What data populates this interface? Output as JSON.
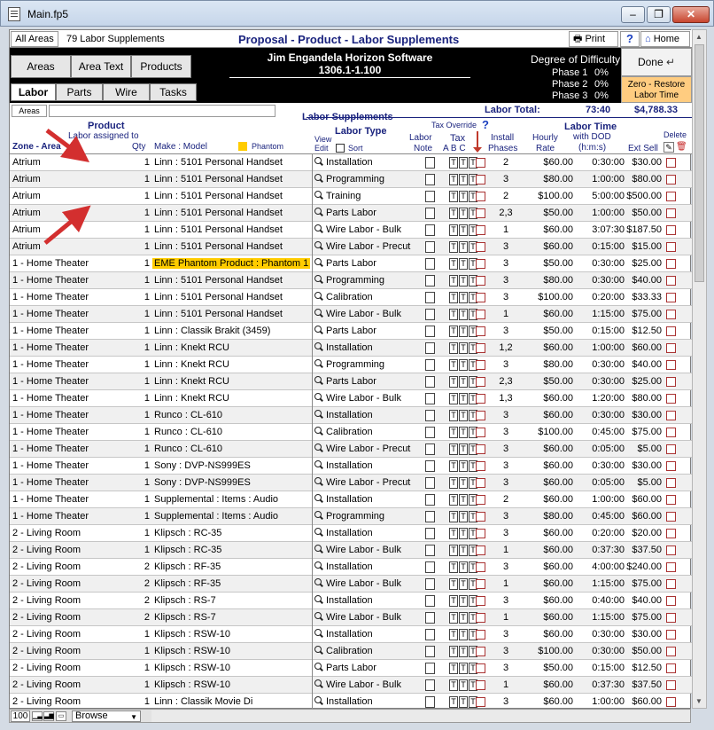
{
  "window": {
    "title": "Main.fp5",
    "min_glyph": "–",
    "max_glyph": "❐",
    "close_glyph": "✕"
  },
  "header": {
    "all_areas_label": "All Areas",
    "count_label": "79  Labor Supplements",
    "title": "Proposal - Product - Labor Supplements",
    "print_label": "Print",
    "help_label": "?",
    "home_label": "Home"
  },
  "nav": {
    "tabs": [
      "Areas",
      "Area Text",
      "Products"
    ],
    "subtabs": [
      "Labor",
      "Parts",
      "Wire",
      "Tasks"
    ]
  },
  "company": {
    "name": "Jim Engandela  Horizon Software",
    "version": "1306.1-1.100"
  },
  "difficulty": {
    "title": "Degree of Difficulty",
    "phases": [
      {
        "label": "Phase 1",
        "value": "0%"
      },
      {
        "label": "Phase 2",
        "value": "0%"
      },
      {
        "label": "Phase 3",
        "value": "0%"
      }
    ]
  },
  "actions": {
    "done_label": "Done",
    "zero_line1": "Zero - Restore",
    "zero_line2": "Labor Time"
  },
  "columns": {
    "areas_btn": "Areas",
    "section_title": "Labor Supplements",
    "labor_total_label": "Labor Total:",
    "labor_total_time": "73:40",
    "labor_total_amount": "$4,788.33",
    "product": "Product",
    "labor_assigned": "Labor assigned to",
    "zone_area": "Zone - Area",
    "qty": "Qty",
    "make_model": "Make : Model",
    "phantom": "Phantom",
    "view": "View",
    "edit": "Edit",
    "labor_type": "Labor Type",
    "sort": "Sort",
    "labor": "Labor",
    "note": "Note",
    "tax_override": "Tax Override",
    "tax": "Tax",
    "tax_abc": "A B C",
    "install": "Install",
    "phases": "Phases",
    "hourly": "Hourly",
    "rate": "Rate",
    "labor_time": "Labor Time",
    "with_dod": "with DOD",
    "hms": "(h:m:s)",
    "ext_sell": "Ext Sell",
    "delete": "Delete"
  },
  "rows": [
    {
      "area": "Atrium",
      "qty": "1",
      "model": "Linn : 5101 Personal Handset",
      "type": "Installation",
      "phases": "2",
      "rate": "$60.00",
      "time": "0:30:00",
      "ext": "$30.00"
    },
    {
      "area": "Atrium",
      "qty": "1",
      "model": "Linn : 5101 Personal Handset",
      "type": "Programming",
      "phases": "3",
      "rate": "$80.00",
      "time": "1:00:00",
      "ext": "$80.00"
    },
    {
      "area": "Atrium",
      "qty": "1",
      "model": "Linn : 5101 Personal Handset",
      "type": "Training",
      "phases": "2",
      "rate": "$100.00",
      "time": "5:00:00",
      "ext": "$500.00"
    },
    {
      "area": "Atrium",
      "qty": "1",
      "model": "Linn : 5101 Personal Handset",
      "type": "Parts Labor",
      "phases": "2,3",
      "rate": "$50.00",
      "time": "1:00:00",
      "ext": "$50.00"
    },
    {
      "area": "Atrium",
      "qty": "1",
      "model": "Linn : 5101 Personal Handset",
      "type": "Wire Labor - Bulk",
      "phases": "1",
      "rate": "$60.00",
      "time": "3:07:30",
      "ext": "$187.50"
    },
    {
      "area": "Atrium",
      "qty": "1",
      "model": "Linn : 5101 Personal Handset",
      "type": "Wire Labor - Precut",
      "phases": "3",
      "rate": "$60.00",
      "time": "0:15:00",
      "ext": "$15.00"
    },
    {
      "area": "1 - Home Theater",
      "qty": "1",
      "model": "EME Phantom Product : Phantom 1",
      "phantom": true,
      "type": "Parts Labor",
      "phases": "3",
      "rate": "$50.00",
      "time": "0:30:00",
      "ext": "$25.00"
    },
    {
      "area": "1 - Home Theater",
      "qty": "1",
      "model": "Linn : 5101 Personal Handset",
      "type": "Programming",
      "phases": "3",
      "rate": "$80.00",
      "time": "0:30:00",
      "ext": "$40.00"
    },
    {
      "area": "1 - Home Theater",
      "qty": "1",
      "model": "Linn : 5101 Personal Handset",
      "type": "Calibration",
      "phases": "3",
      "rate": "$100.00",
      "time": "0:20:00",
      "ext": "$33.33"
    },
    {
      "area": "1 - Home Theater",
      "qty": "1",
      "model": "Linn : 5101 Personal Handset",
      "type": "Wire Labor - Bulk",
      "phases": "1",
      "rate": "$60.00",
      "time": "1:15:00",
      "ext": "$75.00"
    },
    {
      "area": "1 - Home Theater",
      "qty": "1",
      "model": "Linn : Classik Brakit (3459)",
      "type": "Parts Labor",
      "phases": "3",
      "rate": "$50.00",
      "time": "0:15:00",
      "ext": "$12.50"
    },
    {
      "area": "1 - Home Theater",
      "qty": "1",
      "model": "Linn : Knekt RCU",
      "type": "Installation",
      "phases": "1,2",
      "rate": "$60.00",
      "time": "1:00:00",
      "ext": "$60.00"
    },
    {
      "area": "1 - Home Theater",
      "qty": "1",
      "model": "Linn : Knekt RCU",
      "type": "Programming",
      "phases": "3",
      "rate": "$80.00",
      "time": "0:30:00",
      "ext": "$40.00"
    },
    {
      "area": "1 - Home Theater",
      "qty": "1",
      "model": "Linn : Knekt RCU",
      "type": "Parts Labor",
      "phases": "2,3",
      "rate": "$50.00",
      "time": "0:30:00",
      "ext": "$25.00"
    },
    {
      "area": "1 - Home Theater",
      "qty": "1",
      "model": "Linn : Knekt RCU",
      "type": "Wire Labor - Bulk",
      "phases": "1,3",
      "rate": "$60.00",
      "time": "1:20:00",
      "ext": "$80.00"
    },
    {
      "area": "1 - Home Theater",
      "qty": "1",
      "model": "Runco : CL-610",
      "type": "Installation",
      "phases": "3",
      "rate": "$60.00",
      "time": "0:30:00",
      "ext": "$30.00"
    },
    {
      "area": "1 - Home Theater",
      "qty": "1",
      "model": "Runco : CL-610",
      "type": "Calibration",
      "phases": "3",
      "rate": "$100.00",
      "time": "0:45:00",
      "ext": "$75.00"
    },
    {
      "area": "1 - Home Theater",
      "qty": "1",
      "model": "Runco : CL-610",
      "type": "Wire Labor - Precut",
      "phases": "3",
      "rate": "$60.00",
      "time": "0:05:00",
      "ext": "$5.00"
    },
    {
      "area": "1 - Home Theater",
      "qty": "1",
      "model": "Sony : DVP-NS999ES",
      "type": "Installation",
      "phases": "3",
      "rate": "$60.00",
      "time": "0:30:00",
      "ext": "$30.00"
    },
    {
      "area": "1 - Home Theater",
      "qty": "1",
      "model": "Sony : DVP-NS999ES",
      "type": "Wire Labor - Precut",
      "phases": "3",
      "rate": "$60.00",
      "time": "0:05:00",
      "ext": "$5.00"
    },
    {
      "area": "1 - Home Theater",
      "qty": "1",
      "model": "Supplemental : Items : Audio",
      "type": "Installation",
      "phases": "2",
      "rate": "$60.00",
      "time": "1:00:00",
      "ext": "$60.00"
    },
    {
      "area": "1 - Home Theater",
      "qty": "1",
      "model": "Supplemental : Items : Audio",
      "type": "Programming",
      "phases": "3",
      "rate": "$80.00",
      "time": "0:45:00",
      "ext": "$60.00"
    },
    {
      "area": "2 - Living Room",
      "qty": "1",
      "model": "Klipsch : RC-35",
      "type": "Installation",
      "phases": "3",
      "rate": "$60.00",
      "time": "0:20:00",
      "ext": "$20.00"
    },
    {
      "area": "2 - Living Room",
      "qty": "1",
      "model": "Klipsch : RC-35",
      "type": "Wire Labor - Bulk",
      "phases": "1",
      "rate": "$60.00",
      "time": "0:37:30",
      "ext": "$37.50"
    },
    {
      "area": "2 - Living Room",
      "qty": "2",
      "model": "Klipsch : RF-35",
      "type": "Installation",
      "phases": "3",
      "rate": "$60.00",
      "time": "4:00:00",
      "ext": "$240.00"
    },
    {
      "area": "2 - Living Room",
      "qty": "2",
      "model": "Klipsch : RF-35",
      "type": "Wire Labor - Bulk",
      "phases": "1",
      "rate": "$60.00",
      "time": "1:15:00",
      "ext": "$75.00"
    },
    {
      "area": "2 - Living Room",
      "qty": "2",
      "model": "Klipsch : RS-7",
      "type": "Installation",
      "phases": "3",
      "rate": "$60.00",
      "time": "0:40:00",
      "ext": "$40.00"
    },
    {
      "area": "2 - Living Room",
      "qty": "2",
      "model": "Klipsch : RS-7",
      "type": "Wire Labor - Bulk",
      "phases": "1",
      "rate": "$60.00",
      "time": "1:15:00",
      "ext": "$75.00"
    },
    {
      "area": "2 - Living Room",
      "qty": "1",
      "model": "Klipsch : RSW-10",
      "type": "Installation",
      "phases": "3",
      "rate": "$60.00",
      "time": "0:30:00",
      "ext": "$30.00"
    },
    {
      "area": "2 - Living Room",
      "qty": "1",
      "model": "Klipsch : RSW-10",
      "type": "Calibration",
      "phases": "3",
      "rate": "$100.00",
      "time": "0:30:00",
      "ext": "$50.00"
    },
    {
      "area": "2 - Living Room",
      "qty": "1",
      "model": "Klipsch : RSW-10",
      "type": "Parts Labor",
      "phases": "3",
      "rate": "$50.00",
      "time": "0:15:00",
      "ext": "$12.50"
    },
    {
      "area": "2 - Living Room",
      "qty": "1",
      "model": "Klipsch : RSW-10",
      "type": "Wire Labor - Bulk",
      "phases": "1",
      "rate": "$60.00",
      "time": "0:37:30",
      "ext": "$37.50"
    },
    {
      "area": "2 - Living Room",
      "qty": "1",
      "model": "Linn : Classik Movie Di",
      "type": "Installation",
      "phases": "3",
      "rate": "$60.00",
      "time": "1:00:00",
      "ext": "$60.00"
    }
  ],
  "tax_glyph": "T",
  "status": {
    "zoom": "100",
    "mode": "Browse",
    "mode_dd": "▼"
  },
  "colors": {
    "accent": "#1a237e",
    "phantom": "#ffcc00",
    "zero_btn": "#ffcc80",
    "arrow": "#d32f2f"
  }
}
